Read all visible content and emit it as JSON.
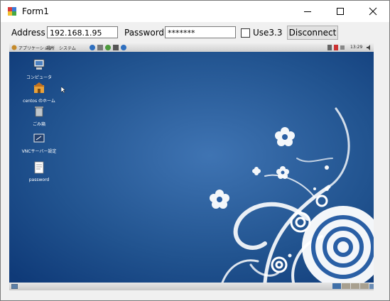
{
  "window": {
    "title": "Form1",
    "minimize_icon": "minimize-icon",
    "maximize_icon": "maximize-icon",
    "close_icon": "close-icon"
  },
  "form": {
    "address_label": "Address",
    "address_value": "192.168.1.95",
    "password_label": "Password",
    "password_value": "*******",
    "use33_label": "Use3.3",
    "use33_checked": false,
    "disconnect_label": "Disconnect"
  },
  "remote": {
    "panel": {
      "menus": [
        "アプリケーション",
        "場所",
        "システム"
      ],
      "clock": "13:29"
    },
    "desktop_icons": [
      {
        "icon": "computer-icon",
        "label": "コンピュータ"
      },
      {
        "icon": "home-folder-icon",
        "label": "centos のホーム"
      },
      {
        "icon": "trash-icon",
        "label": "ごみ箱"
      },
      {
        "icon": "vnc-server-icon",
        "label": "VNCサーバー設定"
      },
      {
        "icon": "document-icon",
        "label": "password"
      }
    ],
    "colors": {
      "wallpaper_dark": "#0f3a78",
      "wallpaper_light": "#3f74b3",
      "swirl": "#ffffff"
    }
  }
}
